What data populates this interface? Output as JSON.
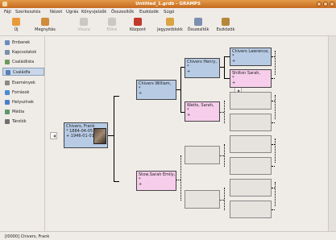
{
  "window": {
    "title": "Untitled_1.grdb - GRAMPS"
  },
  "menu": [
    "Fájl",
    "Szerkesztés",
    "Nézet",
    "Ugrás",
    "Könyvjelzők",
    "Összesítők",
    "Eszközök",
    "Súgó"
  ],
  "toolbar": {
    "new": "Új",
    "open": "Megnyitás",
    "back": "Vissza",
    "forward": "Előre",
    "home": "Központ",
    "notes": "Jegyzetblokk",
    "reports": "Összesítők",
    "tools": "Eszközök"
  },
  "sidebar": [
    {
      "label": "Emberek",
      "color": "#6b8bbf"
    },
    {
      "label": "Kapcsolatok",
      "color": "#7a8fa8"
    },
    {
      "label": "Családlista",
      "color": "#6b9b5a"
    },
    {
      "label": "Családfa",
      "color": "#5a7fb5"
    },
    {
      "label": "Események",
      "color": "#8a8a8a"
    },
    {
      "label": "Források",
      "color": "#4a8ad6"
    },
    {
      "label": "Helyszínek",
      "color": "#4a7fc5"
    },
    {
      "label": "Média",
      "color": "#5c9a6a"
    },
    {
      "label": "Tárolók",
      "color": "#707070"
    }
  ],
  "tree": {
    "root": {
      "name": "Chivers, Frank",
      "birth": "* 1884-04-05",
      "death": "+ 1946-01-01"
    },
    "father": {
      "name": "Chivers William,",
      "birth": "*",
      "death": "+"
    },
    "mother": {
      "name": "Stow,Sarah Emily,",
      "birth": "*",
      "death": "+"
    },
    "pgf": {
      "name": "Chivers Henry,",
      "birth": "*",
      "death": "+"
    },
    "pgm": {
      "name": "Watts, Sarah,",
      "birth": "*",
      "death": "+"
    },
    "ggf": {
      "name": "Chivers Lawrence,",
      "birth": "*",
      "death": "+"
    },
    "ggm": {
      "name": "Shilton Sarah,",
      "birth": "*",
      "death": "+"
    }
  },
  "status": {
    "text": "[I0000] Chivers, Frank"
  }
}
